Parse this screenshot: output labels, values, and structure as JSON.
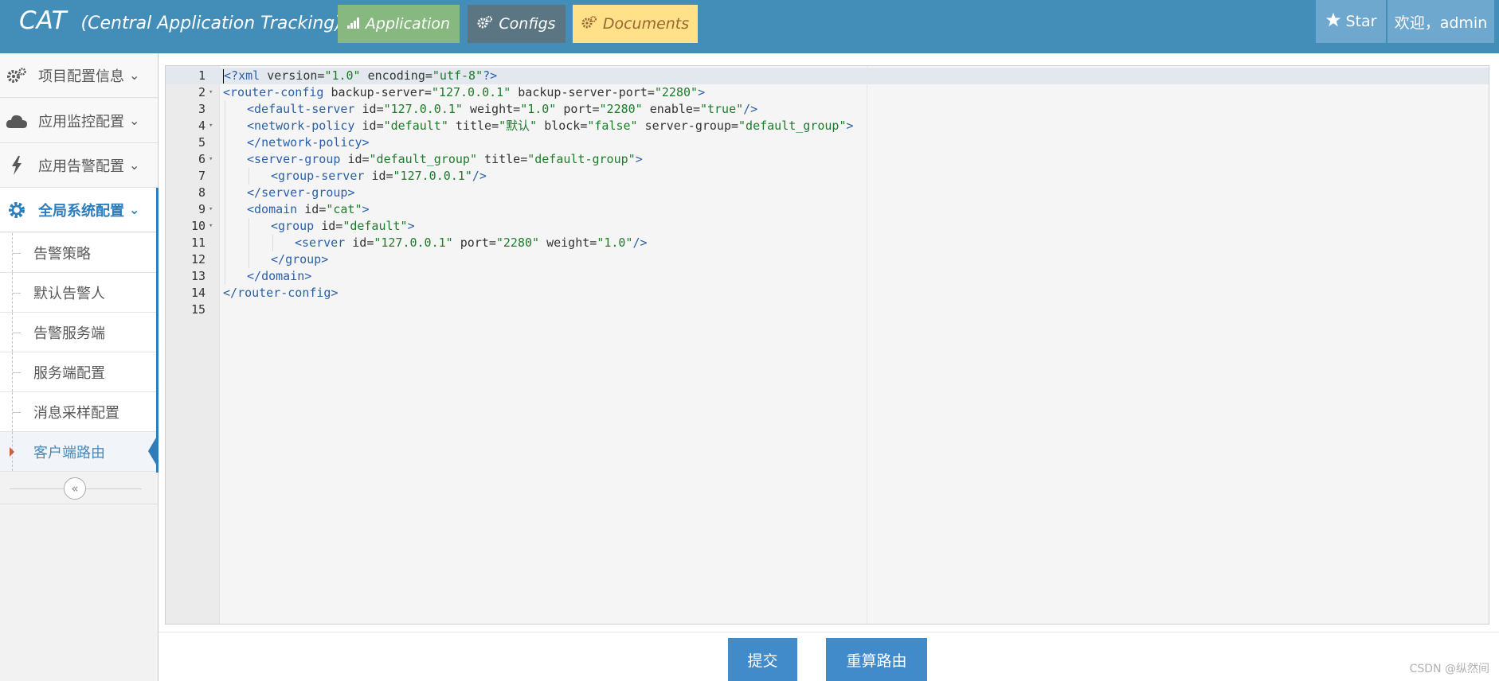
{
  "navbar": {
    "brand": "CAT",
    "brand_sub": "(Central Application Tracking)",
    "tabs": [
      {
        "label": "Application",
        "icon": "signal-icon"
      },
      {
        "label": "Configs",
        "icon": "cogs-icon"
      },
      {
        "label": "Documents",
        "icon": "cogs-icon"
      }
    ],
    "star_label": "Star",
    "user_label": "欢迎，admin"
  },
  "sidebar": {
    "menu": [
      {
        "label": "项目配置信息",
        "icon": "cogs-icon"
      },
      {
        "label": "应用监控配置",
        "icon": "cloud-icon"
      },
      {
        "label": "应用告警配置",
        "icon": "bolt-icon"
      },
      {
        "label": "全局系统配置",
        "icon": "gear-icon",
        "active": true
      }
    ],
    "sub_items": [
      {
        "label": "告警策略"
      },
      {
        "label": "默认告警人"
      },
      {
        "label": "告警服务端"
      },
      {
        "label": "服务端配置"
      },
      {
        "label": "消息采样配置"
      },
      {
        "label": "客户端路由",
        "active": true
      }
    ],
    "collapse_icon": "double-angle-left-icon"
  },
  "editor": {
    "lines": [
      {
        "num": "1",
        "fold": false,
        "indent": 0,
        "text": "<?xml version=\"1.0\" encoding=\"utf-8\"?>"
      },
      {
        "num": "2",
        "fold": true,
        "indent": 0,
        "text": "<router-config backup-server=\"127.0.0.1\" backup-server-port=\"2280\">"
      },
      {
        "num": "3",
        "fold": false,
        "indent": 1,
        "text": "<default-server id=\"127.0.0.1\" weight=\"1.0\" port=\"2280\" enable=\"true\"/>"
      },
      {
        "num": "4",
        "fold": true,
        "indent": 1,
        "text": "<network-policy id=\"default\" title=\"默认\" block=\"false\" server-group=\"default_group\">"
      },
      {
        "num": "5",
        "fold": false,
        "indent": 1,
        "text": "</network-policy>"
      },
      {
        "num": "6",
        "fold": true,
        "indent": 1,
        "text": "<server-group id=\"default_group\" title=\"default-group\">"
      },
      {
        "num": "7",
        "fold": false,
        "indent": 2,
        "text": "<group-server id=\"127.0.0.1\"/>"
      },
      {
        "num": "8",
        "fold": false,
        "indent": 1,
        "text": "</server-group>"
      },
      {
        "num": "9",
        "fold": true,
        "indent": 1,
        "text": "<domain id=\"cat\">"
      },
      {
        "num": "10",
        "fold": true,
        "indent": 2,
        "text": "<group id=\"default\">"
      },
      {
        "num": "11",
        "fold": false,
        "indent": 3,
        "text": "<server id=\"127.0.0.1\" port=\"2280\" weight=\"1.0\"/>"
      },
      {
        "num": "12",
        "fold": false,
        "indent": 2,
        "text": "</group>"
      },
      {
        "num": "13",
        "fold": false,
        "indent": 1,
        "text": "</domain>"
      },
      {
        "num": "14",
        "fold": false,
        "indent": 0,
        "text": "</router-config>"
      },
      {
        "num": "15",
        "fold": false,
        "indent": 0,
        "text": ""
      }
    ]
  },
  "actions": {
    "submit_label": "提交",
    "recalc_label": "重算路由"
  },
  "watermark": "CSDN @纵然间"
}
